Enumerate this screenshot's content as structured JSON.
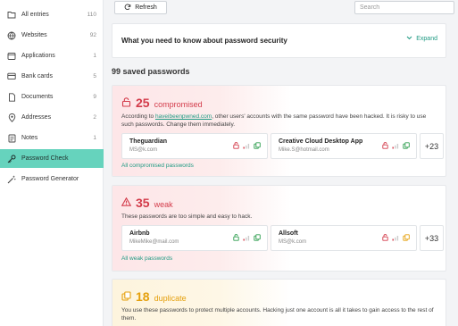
{
  "sidebar": {
    "items": [
      {
        "label": "All entries",
        "count": "110",
        "icon": "folder-icon"
      },
      {
        "label": "Websites",
        "count": "92",
        "icon": "globe-icon"
      },
      {
        "label": "Applications",
        "count": "1",
        "icon": "app-window-icon"
      },
      {
        "label": "Bank cards",
        "count": "5",
        "icon": "credit-card-icon"
      },
      {
        "label": "Documents",
        "count": "9",
        "icon": "document-icon"
      },
      {
        "label": "Addresses",
        "count": "2",
        "icon": "location-pin-icon"
      },
      {
        "label": "Notes",
        "count": "1",
        "icon": "note-icon"
      },
      {
        "label": "Password Check",
        "count": "",
        "icon": "key-icon",
        "active": true
      },
      {
        "label": "Password Generator",
        "count": "",
        "icon": "magic-wand-icon"
      }
    ]
  },
  "toolbar": {
    "refresh_label": "Refresh",
    "search_placeholder": "Search"
  },
  "info": {
    "title": "What you need to know about password security",
    "expand_label": "Expand"
  },
  "saved_title": "99 saved passwords",
  "groups": {
    "compromised": {
      "count": "25",
      "word": "compromised",
      "desc_before": "According to ",
      "desc_link": "haveibeenpwned.com",
      "desc_after": ", other users' accounts with the same password have been hacked. It is risky to use such passwords. Change them immediately.",
      "entries": [
        {
          "name": "Theguardian",
          "email": "MS@k.com"
        },
        {
          "name": "Creative Cloud Desktop App",
          "email": "Mike.S@hotmail.com"
        }
      ],
      "more": "+23",
      "all_link": "All compromised passwords"
    },
    "weak": {
      "count": "35",
      "word": "weak",
      "desc": "These passwords are too simple and easy to hack.",
      "entries": [
        {
          "name": "Airbnb",
          "email": "MikeMike@mail.com"
        },
        {
          "name": "Allsoft",
          "email": "MS@k.com"
        }
      ],
      "more": "+33",
      "all_link": "All weak passwords"
    },
    "duplicate": {
      "count": "18",
      "word": "duplicate",
      "desc": "You use these passwords to protect multiple accounts. Hacking just one account is all it takes to gain access to the rest of them."
    }
  },
  "colors": {
    "accent": "#1f9a83",
    "active_bg": "#66d3bd",
    "danger": "#d33b4a",
    "warning": "#e5a00d"
  }
}
